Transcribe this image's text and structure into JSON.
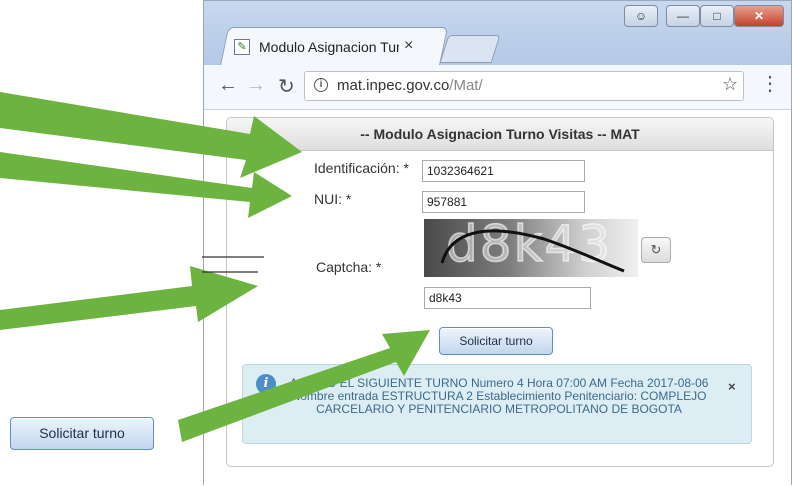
{
  "browser": {
    "tab_title": "Modulo Asignacion Turn",
    "tab_close": "×",
    "url_host": "mat.inpec.gov.co",
    "url_path": "/Mat/",
    "icons": {
      "back": "back-arrow-icon",
      "forward": "forward-arrow-icon",
      "reload": "reload-icon",
      "info": "info-icon",
      "star": "star-icon",
      "menu": "kebab-menu-icon"
    }
  },
  "form": {
    "header": "-- Modulo Asignacion Turno Visitas -- MAT",
    "identificacion_label": "Identificación: *",
    "identificacion_value": "1032364621",
    "nui_label": "NUI: *",
    "nui_value": "957881",
    "captcha_label": "Captcha: *",
    "captcha_image_text": "d8k43",
    "captcha_value": "d8k43",
    "submit_label": "Solicitar turno"
  },
  "alert": {
    "text": "ASIGNO EL SIGUIENTE TURNO Numero 4 Hora 07:00 AM Fecha 2017-08-06 Nombre entrada ESTRUCTURA 2 Establecimiento Penitenciario: COMPLEJO CARCELARIO Y PENITENCIARIO METROPOLITANO DE BOGOTA",
    "close": "×"
  },
  "standalone_button": {
    "label": "Solicitar turno"
  },
  "colors": {
    "arrow": "#6db33f",
    "alert_bg": "#dcedf4",
    "alert_text": "#3b6a8a"
  }
}
